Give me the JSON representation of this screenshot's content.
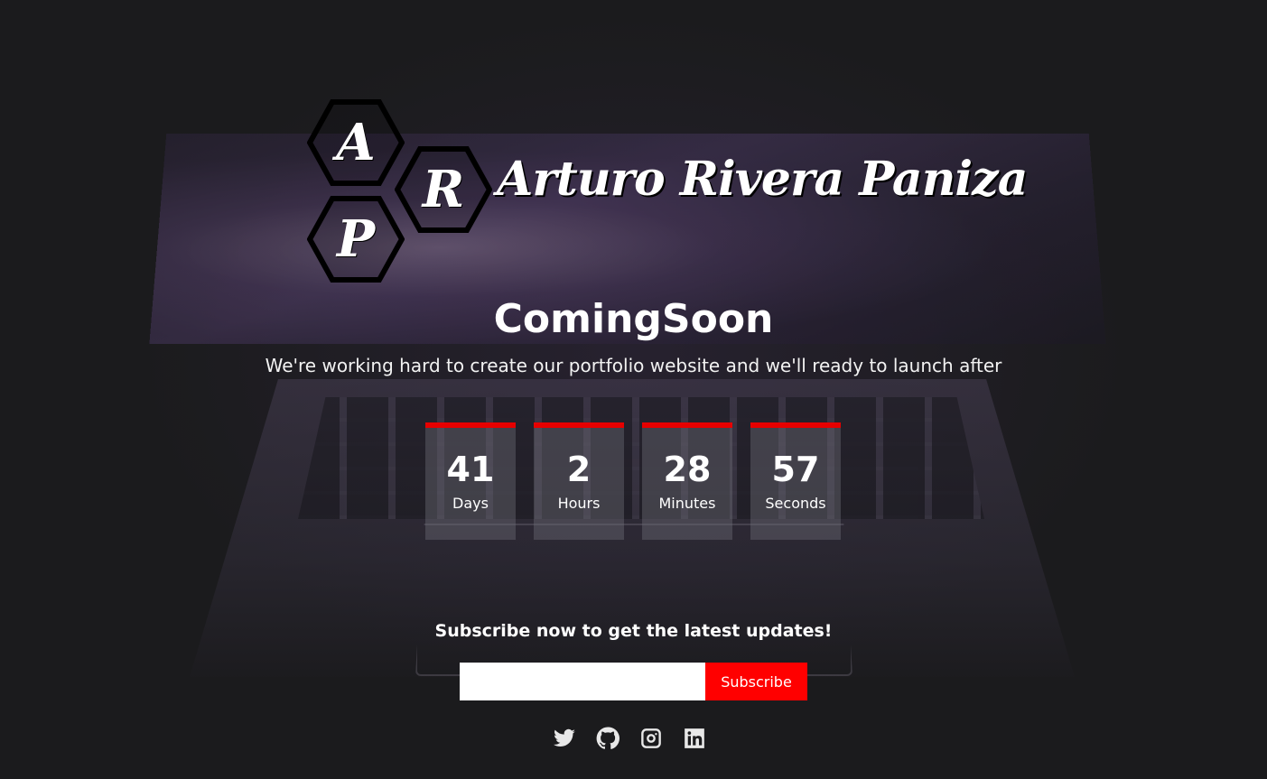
{
  "logo": {
    "letters": [
      "A",
      "R",
      "P"
    ],
    "name": "Arturo Rivera Paniza"
  },
  "hero": {
    "title": "ComingSoon",
    "subtitle": "We're working hard to create our portfolio website and we'll ready to launch after"
  },
  "countdown": [
    {
      "value": "41",
      "label": "Days"
    },
    {
      "value": "2",
      "label": "Hours"
    },
    {
      "value": "28",
      "label": "Minutes"
    },
    {
      "value": "57",
      "label": "Seconds"
    }
  ],
  "subscribe": {
    "heading": "Subscribe now to get the latest updates!",
    "email_value": "",
    "button_label": "Subscribe"
  },
  "socials": [
    {
      "icon": "twitter-icon"
    },
    {
      "icon": "github-icon"
    },
    {
      "icon": "instagram-icon"
    },
    {
      "icon": "linkedin-icon"
    }
  ],
  "colors": {
    "accent": "#ff0000",
    "background": "#1a1a1c"
  }
}
